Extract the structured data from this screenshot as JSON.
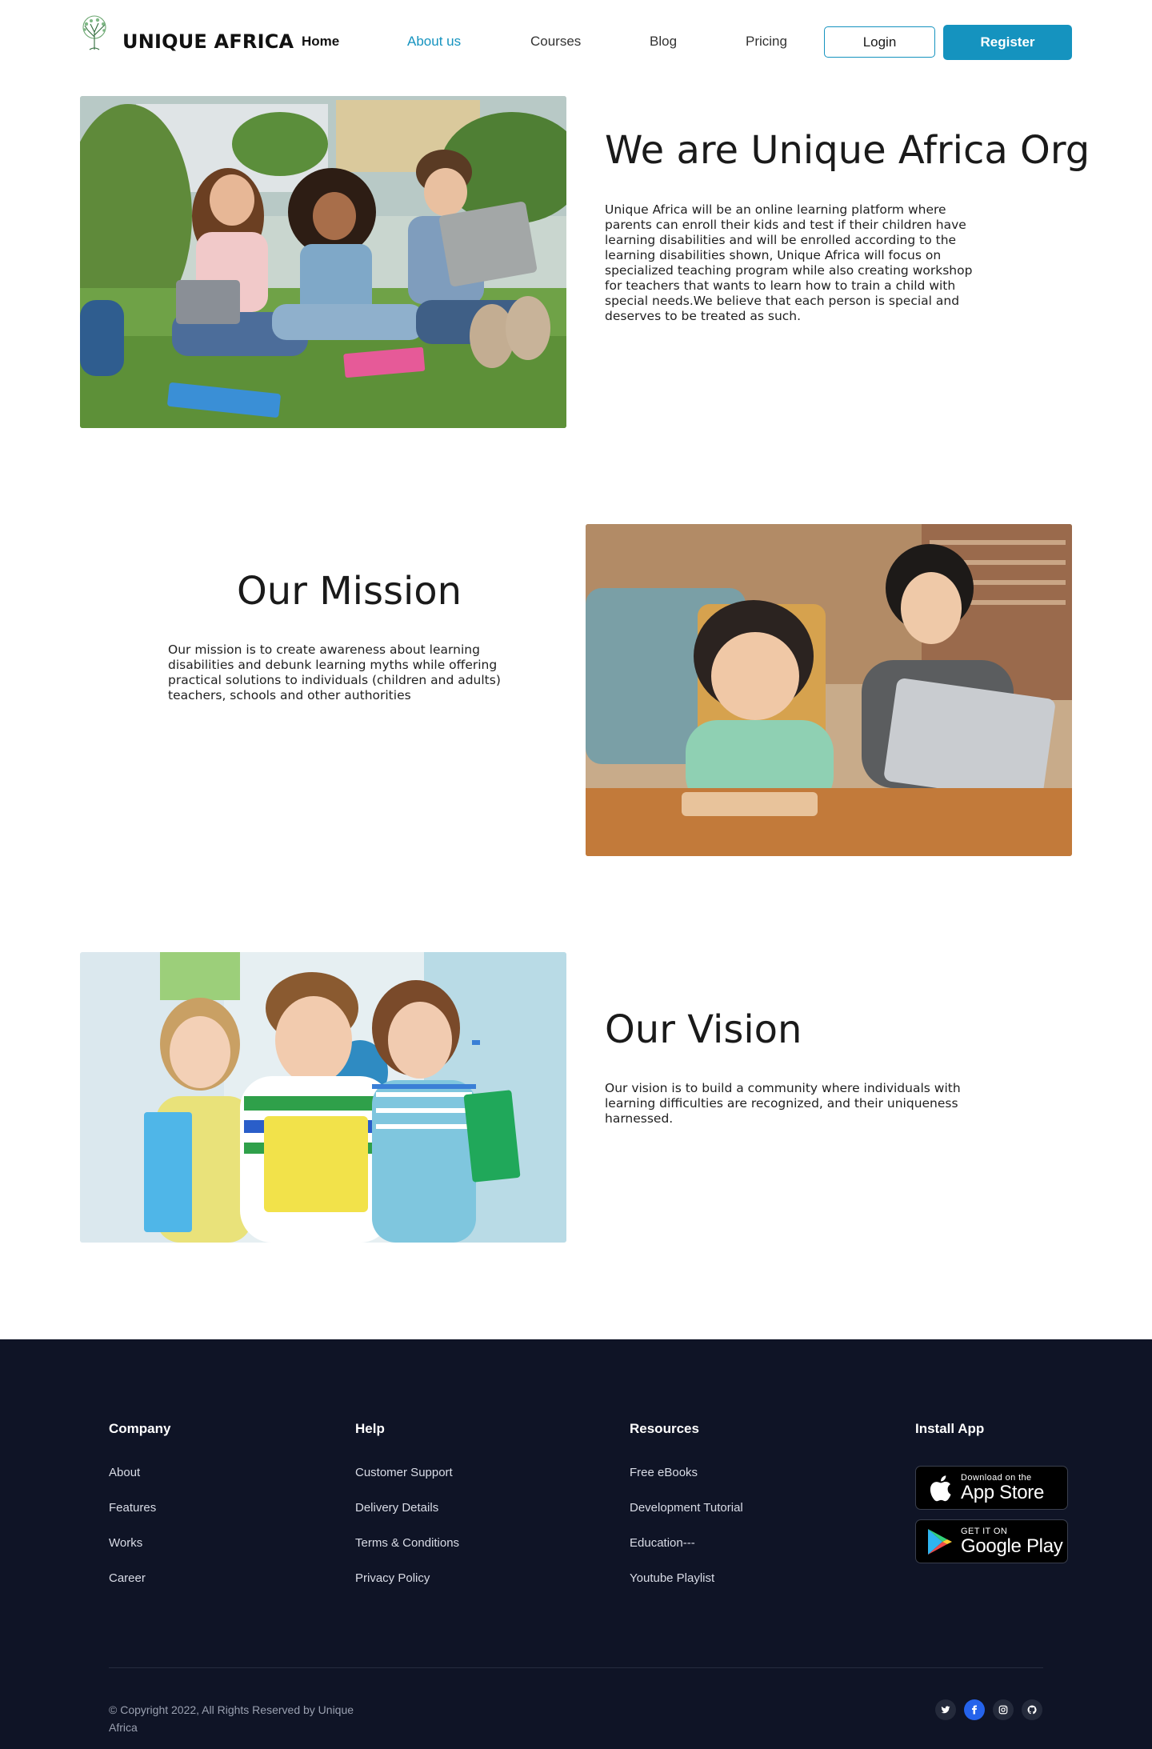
{
  "nav": {
    "brand": "UNIQUE AFRICA",
    "links": [
      {
        "label": "Home",
        "state": "active"
      },
      {
        "label": "About us",
        "state": "current"
      },
      {
        "label": "Courses",
        "state": "normal"
      },
      {
        "label": "Blog",
        "state": "normal"
      },
      {
        "label": "Pricing",
        "state": "normal"
      }
    ],
    "login_label": "Login",
    "register_label": "Register"
  },
  "about": {
    "title": "We are Unique Africa Org",
    "body": "Unique Africa  will be an online learning platform where parents can enroll their kids and test if their children have learning disabilities and will be enrolled according to the learning disabilities shown, Unique Africa will focus on specialized teaching program while also creating workshop for teachers that wants to learn how to train a child with special needs.We believe that each person is special and deserves to be treated as such."
  },
  "mission": {
    "title": "Our Mission",
    "body": "Our mission is to create awareness about learning disabilities and debunk learning myths while offering practical solutions to individuals (children and adults) teachers, schools and other authorities"
  },
  "vision": {
    "title": "Our Vision",
    "body": "Our vision is to build a community where individuals with learning difficulties are recognized, and their uniqueness harnessed."
  },
  "footer": {
    "columns": [
      {
        "heading": "Company",
        "links": [
          "About",
          "Features",
          "Works",
          "Career"
        ]
      },
      {
        "heading": "Help",
        "links": [
          "Customer Support",
          "Delivery Details",
          "Terms & Conditions",
          "Privacy Policy"
        ]
      },
      {
        "heading": "Resources",
        "links": [
          "Free eBooks",
          "Development Tutorial",
          "Education---",
          "Youtube Playlist"
        ]
      }
    ],
    "install_heading": "Install App",
    "app_store": {
      "small": "Download on the",
      "big": "App Store"
    },
    "google_play": {
      "small": "GET IT ON",
      "big": "Google Play"
    },
    "copyright": "© Copyright 2022, All Rights Reserved by Unique Africa",
    "social_icons": [
      "twitter-icon",
      "facebook-icon",
      "instagram-icon",
      "github-icon"
    ]
  },
  "colors": {
    "accent": "#1593bf",
    "footer_bg": "#0f1426",
    "facebook": "#2563eb"
  }
}
